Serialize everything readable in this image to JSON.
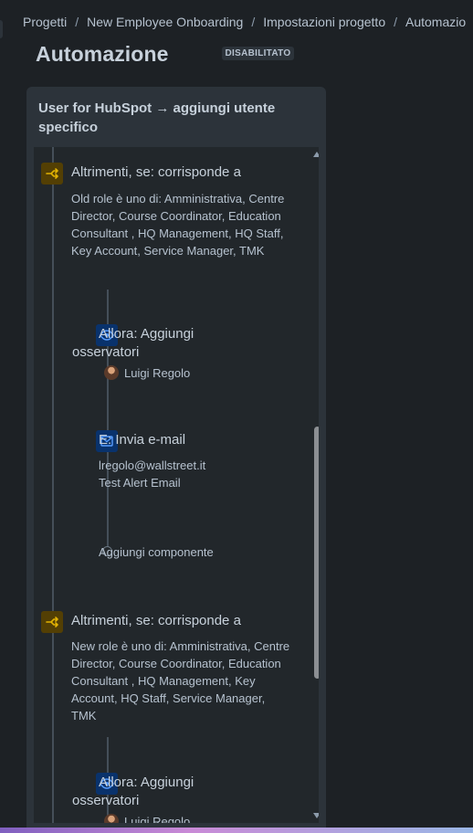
{
  "breadcrumb": {
    "items": [
      "Progetti",
      "New Employee Onboarding",
      "Impostazioni progetto",
      "Automazio"
    ],
    "separator": "/"
  },
  "page": {
    "title": "Automazione",
    "status_badge": "DISABILITATO"
  },
  "rule": {
    "title": "User for HubSpot → aggiungi utente specifico",
    "components": {
      "condition_1": {
        "title": "Altrimenti, se: corrisponde a",
        "text": "Old role è uno di: Amministrativa, Centre Director, Course Coordinator, Education Consultant , HQ Management, HQ Staff, Key Account, Service Manager, TMK",
        "icon": "branch-icon"
      },
      "action_watchers_1": {
        "title": "Allora: Aggiungi osservatori",
        "user": "Luigi Regolo",
        "icon": "eye-icon"
      },
      "action_email": {
        "title": "E: Invia e-mail",
        "recipient": "lregolo@wallstreet.it",
        "subject": "Test Alert Email",
        "icon": "mail-icon"
      },
      "add_component": {
        "label": "Aggiungi componente"
      },
      "condition_2": {
        "title": "Altrimenti, se: corrisponde a",
        "text": "New role è uno di: Amministrativa, Centre Director, Course Coordinator, Education Consultant , HQ Management, Key Account, HQ Staff, Service Manager, TMK",
        "icon": "branch-icon"
      },
      "action_watchers_2": {
        "title": "Allora: Aggiungi osservatori",
        "user": "Luigi Regolo",
        "icon": "eye-icon"
      }
    }
  },
  "colors": {
    "background": "#1d2125",
    "card": "#2c333a",
    "panel": "#22272b",
    "condition_icon_bg": "#533f04",
    "condition_icon_fg": "#e2b203",
    "action_icon_bg": "#09326c",
    "action_icon_fg": "#579dff"
  }
}
